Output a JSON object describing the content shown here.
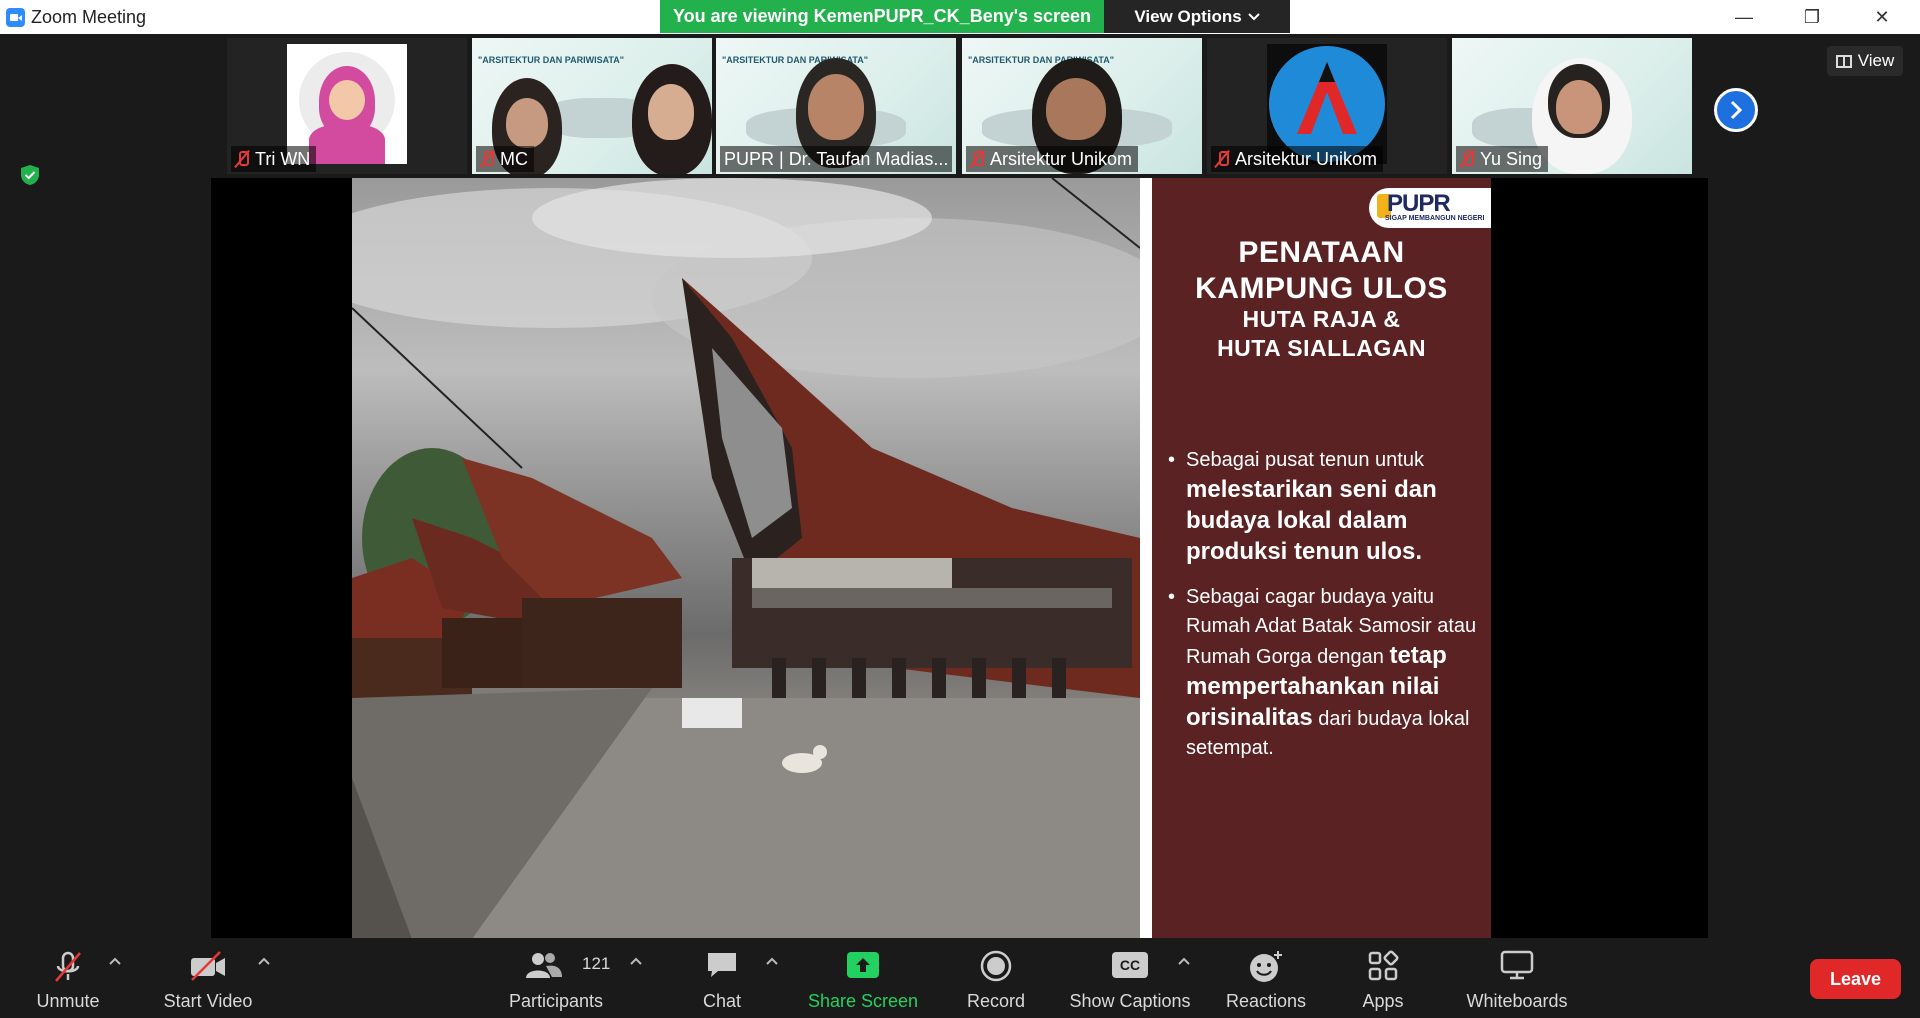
{
  "window": {
    "title": "Zoom Meeting",
    "controls": {
      "minimize": "—",
      "restore": "❐",
      "close": "✕"
    }
  },
  "banner": {
    "viewing": "You are viewing KemenPUPR_CK_Beny's screen",
    "view_options": "View Options",
    "view_options_icon": "chevron-down-icon"
  },
  "gallery": {
    "view_label": "View",
    "tiles": [
      {
        "name": "Tri WN",
        "muted": true
      },
      {
        "name": "MC",
        "muted": true
      },
      {
        "name": "PUPR | Dr. Taufan Madias...",
        "muted": false,
        "active": true
      },
      {
        "name": "Arsitektur Unikom",
        "muted": true
      },
      {
        "name": "Arsitektur Unikom",
        "muted": true
      },
      {
        "name": "Yu Sing",
        "muted": true
      }
    ],
    "slide_thumb_text": "\"ARSITEKTUR DAN PARIWISATA\""
  },
  "slide": {
    "logo": {
      "name": "PUPR",
      "tagline": "SIGAP MEMBANGUN NEGERI"
    },
    "title_line1": "PENATAAN",
    "title_line2": "KAMPUNG ULOS",
    "subtitle_line1": "HUTA RAJA &",
    "subtitle_line2": "HUTA SIALLAGAN",
    "bullet1": {
      "lead": "Sebagai pusat tenun untuk ",
      "bold": "melestarikan seni dan budaya lokal dalam produksi tenun ulos."
    },
    "bullet2": {
      "lead": "Sebagai cagar budaya yaitu Rumah Adat Batak Samosir atau Rumah Gorga dengan ",
      "bold": "tetap mempertahankan nilai orisinalitas",
      "tail": " dari budaya lokal setempat."
    },
    "colors": {
      "panel": "#5a2223",
      "text": "#ffffff"
    }
  },
  "toolbar": {
    "unmute": "Unmute",
    "start_video": "Start Video",
    "participants": "Participants",
    "participants_count": "121",
    "chat": "Chat",
    "share_screen": "Share Screen",
    "record": "Record",
    "show_captions": "Show Captions",
    "captions_badge": "CC",
    "reactions": "Reactions",
    "apps": "Apps",
    "whiteboards": "Whiteboards",
    "leave": "Leave",
    "colors": {
      "share": "#23d160",
      "leave": "#e02828"
    }
  }
}
